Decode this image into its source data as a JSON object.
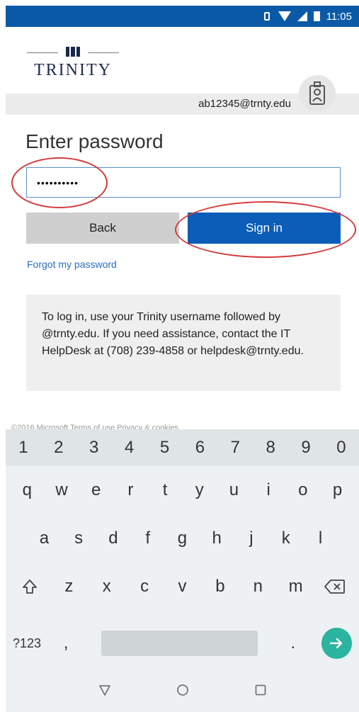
{
  "status_bar": {
    "time": "11:05"
  },
  "header": {
    "logo_text": "TRINITY",
    "account_email": "ab12345@trnty.edu"
  },
  "form": {
    "title": "Enter password",
    "password_value": "••••••••••",
    "back_label": "Back",
    "signin_label": "Sign in",
    "forgot_label": "Forgot my password"
  },
  "info": {
    "text": "To log in, use your Trinity username followed by @trnty.edu. If you need assistance, contact the IT HelpDesk at (708) 239-4858 or helpdesk@trnty.edu."
  },
  "footer": {
    "text": "©2016 Microsoft     Terms of use     Privacy & cookies"
  },
  "keyboard": {
    "numbers": [
      "1",
      "2",
      "3",
      "4",
      "5",
      "6",
      "7",
      "8",
      "9",
      "0"
    ],
    "row1": [
      "q",
      "w",
      "e",
      "r",
      "t",
      "y",
      "u",
      "i",
      "o",
      "p"
    ],
    "row2": [
      "a",
      "s",
      "d",
      "f",
      "g",
      "h",
      "j",
      "k",
      "l"
    ],
    "row3": [
      "z",
      "x",
      "c",
      "v",
      "b",
      "n",
      "m"
    ],
    "symbols_label": "?123",
    "comma": ",",
    "period": "."
  },
  "colors": {
    "accent": "#0b5db8",
    "status_bar": "#0b5aa8",
    "annotation": "#d63a3a",
    "enter_key": "#2bb49f"
  },
  "icons": {
    "status": [
      "vibrate-icon",
      "wifi-icon",
      "signal-icon",
      "battery-icon"
    ],
    "avatar": "badge-person-icon",
    "shift": "shift-icon",
    "backspace": "backspace-icon",
    "enter": "arrow-right-icon",
    "nav": [
      "back-triangle-icon",
      "home-circle-icon",
      "recents-square-icon"
    ]
  }
}
